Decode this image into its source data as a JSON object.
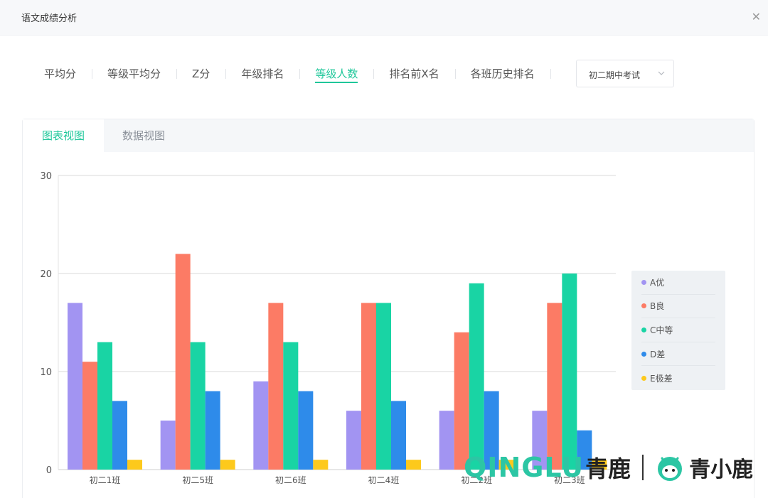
{
  "window": {
    "title": "语文成绩分析",
    "close_icon": "close-icon"
  },
  "tabs": [
    {
      "label": "平均分",
      "active": false
    },
    {
      "label": "等级平均分",
      "active": false
    },
    {
      "label": "Z分",
      "active": false
    },
    {
      "label": "年级排名",
      "active": false
    },
    {
      "label": "等级人数",
      "active": true
    },
    {
      "label": "排名前X名",
      "active": false
    },
    {
      "label": "各班历史排名",
      "active": false
    }
  ],
  "exam_select": {
    "value": "初二期中考试",
    "icon": "chevron-down-icon"
  },
  "view_tabs": {
    "chart": "图表视图",
    "data": "数据视图"
  },
  "colors": {
    "accent": "#1fc79a",
    "A": "#a294f2",
    "B": "#fc7b65",
    "C": "#19d4a4",
    "D": "#2e8bea",
    "E": "#fdc91c"
  },
  "chart_data": {
    "type": "bar",
    "categories": [
      "初二1班",
      "初二5班",
      "初二6班",
      "初二4班",
      "初二2班",
      "初二3班"
    ],
    "series": [
      {
        "name": "A优",
        "color": "#a294f2",
        "values": [
          17,
          5,
          9,
          6,
          6,
          6
        ]
      },
      {
        "name": "B良",
        "color": "#fc7b65",
        "values": [
          11,
          22,
          17,
          17,
          14,
          17
        ]
      },
      {
        "name": "C中等",
        "color": "#19d4a4",
        "values": [
          13,
          13,
          13,
          17,
          19,
          20
        ]
      },
      {
        "name": "D差",
        "color": "#2e8bea",
        "values": [
          7,
          8,
          8,
          7,
          8,
          4
        ]
      },
      {
        "name": "E极差",
        "color": "#fdc91c",
        "values": [
          1,
          1,
          1,
          1,
          1,
          1
        ]
      }
    ],
    "ylim": [
      0,
      30
    ],
    "yticks": [
      "0",
      "10",
      "20",
      "30"
    ],
    "grid": true,
    "legend": "right"
  },
  "watermark": {
    "latin": "QINGLU",
    "cn": "青鹿",
    "cn2": "青小鹿"
  }
}
